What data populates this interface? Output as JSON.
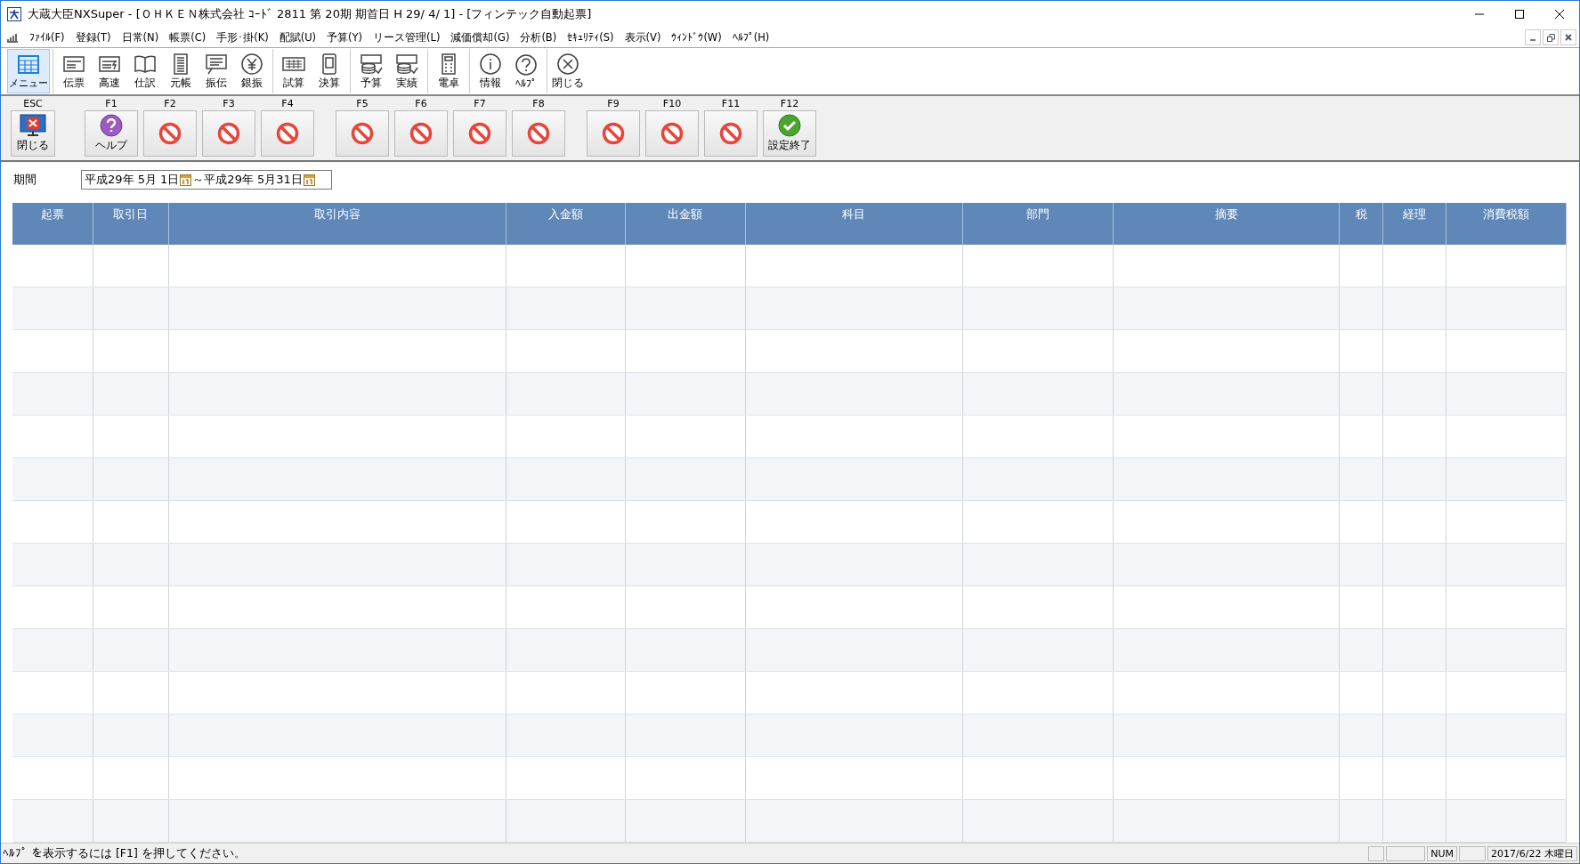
{
  "window": {
    "title": "大蔵大臣NXSuper - [ＯＨＫＥＮ株式会社 ｺｰﾄﾞ 2811 第 20期 期首日 H 29/  4/  1] - [フィンテック自動起票]"
  },
  "menu": [
    "ﾌｧｲﾙ(F)",
    "登録(T)",
    "日常(N)",
    "帳票(C)",
    "手形･掛(K)",
    "配賦(U)",
    "予算(Y)",
    "リース管理(L)",
    "減価償却(G)",
    "分析(B)",
    "ｾｷｭﾘﾃｨ(S)",
    "表示(V)",
    "ｳｨﾝﾄﾞｳ(W)",
    "ﾍﾙﾌﾟ(H)"
  ],
  "toolbar": {
    "groups": [
      {
        "items": [
          {
            "label": "メニュー",
            "kind": "grid",
            "selected": true
          }
        ]
      },
      {
        "items": [
          {
            "label": "伝票",
            "kind": "slip",
            "selected": false
          },
          {
            "label": "高速",
            "kind": "fast",
            "selected": false
          },
          {
            "label": "仕訳",
            "kind": "book",
            "selected": false
          },
          {
            "label": "元帳",
            "kind": "ledger",
            "selected": false
          },
          {
            "label": "振伝",
            "kind": "board",
            "selected": false
          },
          {
            "label": "銀振",
            "kind": "yen",
            "selected": false
          }
        ]
      },
      {
        "items": [
          {
            "label": "試算",
            "kind": "keyboard",
            "selected": false
          },
          {
            "label": "決算",
            "kind": "tablet",
            "selected": false
          }
        ]
      },
      {
        "items": [
          {
            "label": "予算",
            "kind": "coins",
            "selected": false
          },
          {
            "label": "実績",
            "kind": "coins",
            "selected": false
          }
        ]
      },
      {
        "items": [
          {
            "label": "電卓",
            "kind": "calc",
            "selected": false
          }
        ]
      },
      {
        "items": [
          {
            "label": "情報",
            "kind": "info",
            "selected": false
          },
          {
            "label": "ﾍﾙﾌﾟ",
            "kind": "help",
            "selected": false
          }
        ]
      },
      {
        "items": [
          {
            "label": "閉じる",
            "kind": "close",
            "selected": false
          }
        ]
      }
    ]
  },
  "function_keys": {
    "groups": [
      [
        {
          "key": "ESC",
          "label": "閉じる",
          "kind": "close"
        }
      ],
      [
        {
          "key": "F1",
          "label": "ヘルプ",
          "kind": "help"
        },
        {
          "key": "F2",
          "kind": "disabled"
        },
        {
          "key": "F3",
          "kind": "disabled"
        },
        {
          "key": "F4",
          "kind": "disabled"
        }
      ],
      [
        {
          "key": "F5",
          "kind": "disabled"
        },
        {
          "key": "F6",
          "kind": "disabled"
        },
        {
          "key": "F7",
          "kind": "disabled"
        },
        {
          "key": "F8",
          "kind": "disabled"
        }
      ],
      [
        {
          "key": "F9",
          "kind": "disabled"
        },
        {
          "key": "F10",
          "kind": "disabled"
        },
        {
          "key": "F11",
          "kind": "disabled"
        },
        {
          "key": "F12",
          "label": "設定終了",
          "kind": "ok"
        }
      ]
    ]
  },
  "period": {
    "label": "期間",
    "start": "平成29年 5月 1日",
    "separator": "～",
    "end": "平成29年 5月31日"
  },
  "table": {
    "columns": [
      "起票",
      "取引日",
      "取引内容",
      "入金額",
      "出金額",
      "科目",
      "部門",
      "摘要",
      "税",
      "経理",
      "消費税額"
    ]
  },
  "status_bar": {
    "message": "ﾍﾙﾌﾟ を表示するには [F1] を押してください。",
    "panels": [
      "NUM",
      "2017/6/22 木曜日"
    ]
  }
}
